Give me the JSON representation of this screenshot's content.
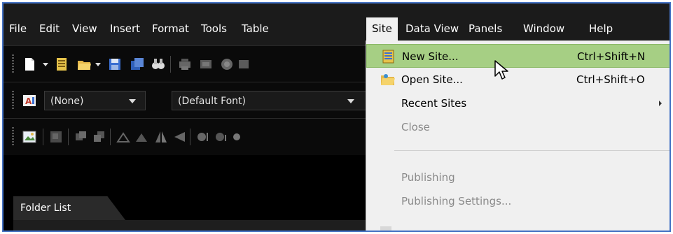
{
  "menubar": {
    "items": [
      {
        "label": "File"
      },
      {
        "label": "Edit"
      },
      {
        "label": "View"
      },
      {
        "label": "Insert"
      },
      {
        "label": "Format"
      },
      {
        "label": "Tools"
      },
      {
        "label": "Table"
      },
      {
        "label": "Site"
      },
      {
        "label": "Data View"
      },
      {
        "label": "Panels"
      },
      {
        "label": "Window"
      },
      {
        "label": "Help"
      }
    ],
    "active": "Site"
  },
  "toolbar_format": {
    "style_value": "(None)",
    "font_value": "(Default Font)"
  },
  "folder_list": {
    "tab_label": "Folder List"
  },
  "site_menu": {
    "items": [
      {
        "label": "New Site...",
        "shortcut": "Ctrl+Shift+N",
        "icon": "new-site-icon",
        "highlighted": true
      },
      {
        "label": "Open Site...",
        "shortcut": "Ctrl+Shift+O",
        "icon": "open-site-icon"
      },
      {
        "label": "Recent Sites",
        "submenu": true
      },
      {
        "label": "Close",
        "disabled": true
      },
      {
        "label": "Publishing",
        "disabled": true
      },
      {
        "label": "Publishing Settings...",
        "disabled": true
      }
    ]
  },
  "colors": {
    "highlight": "#a6cf84",
    "menu_bg": "#f0f0f0",
    "app_bg": "#000000",
    "frame_border": "#4472c4"
  }
}
